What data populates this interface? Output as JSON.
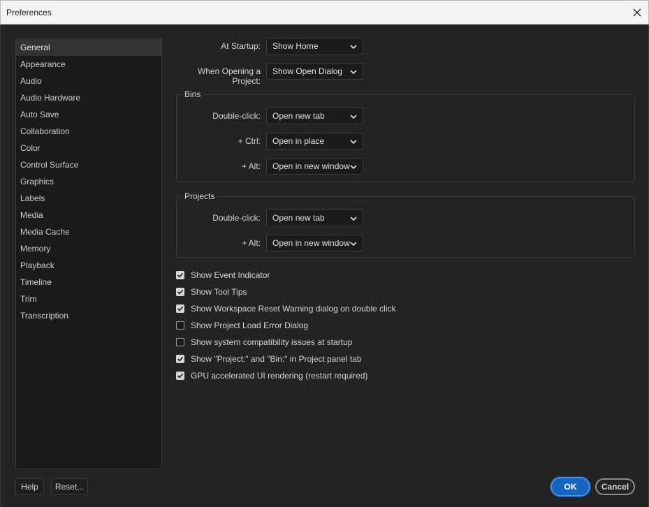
{
  "window": {
    "title": "Preferences"
  },
  "sidebar": {
    "items": [
      {
        "label": "General"
      },
      {
        "label": "Appearance"
      },
      {
        "label": "Audio"
      },
      {
        "label": "Audio Hardware"
      },
      {
        "label": "Auto Save"
      },
      {
        "label": "Collaboration"
      },
      {
        "label": "Color"
      },
      {
        "label": "Control Surface"
      },
      {
        "label": "Graphics"
      },
      {
        "label": "Labels"
      },
      {
        "label": "Media"
      },
      {
        "label": "Media Cache"
      },
      {
        "label": "Memory"
      },
      {
        "label": "Playback"
      },
      {
        "label": "Timeline"
      },
      {
        "label": "Trim"
      },
      {
        "label": "Transcription"
      }
    ],
    "active": "General"
  },
  "general": {
    "at_startup": {
      "label": "At Startup:",
      "value": "Show Home"
    },
    "opening_project": {
      "label": "When Opening a Project:",
      "value": "Show Open Dialog"
    },
    "bins": {
      "title": "Bins",
      "double_click": {
        "label": "Double-click:",
        "value": "Open new tab"
      },
      "ctrl": {
        "label": "+ Ctrl:",
        "value": "Open in place"
      },
      "alt": {
        "label": "+ Alt:",
        "value": "Open in new window"
      }
    },
    "projects": {
      "title": "Projects",
      "double_click": {
        "label": "Double-click:",
        "value": "Open new tab"
      },
      "alt": {
        "label": "+ Alt:",
        "value": "Open in new window"
      }
    },
    "checkboxes": [
      {
        "label": "Show Event Indicator",
        "checked": true
      },
      {
        "label": "Show Tool Tips",
        "checked": true
      },
      {
        "label": "Show Workspace Reset Warning dialog on double click",
        "checked": true
      },
      {
        "label": "Show Project Load Error Dialog",
        "checked": false
      },
      {
        "label": "Show system compatibility issues at startup",
        "checked": false
      },
      {
        "label": "Show \"Project:\" and \"Bin:\" in Project panel tab",
        "checked": true
      },
      {
        "label": "GPU accelerated UI rendering (restart required)",
        "checked": true
      }
    ]
  },
  "footer": {
    "help_label": "Help",
    "reset_label": "Reset...",
    "ok_label": "OK",
    "cancel_label": "Cancel"
  },
  "icons": {
    "close": "close-icon",
    "dropdown": "chevron-down-icon",
    "check": "checkmark-icon"
  },
  "colors": {
    "accent": "#1565c0",
    "panel_bg": "#232323",
    "list_bg": "#1a1a1a"
  }
}
